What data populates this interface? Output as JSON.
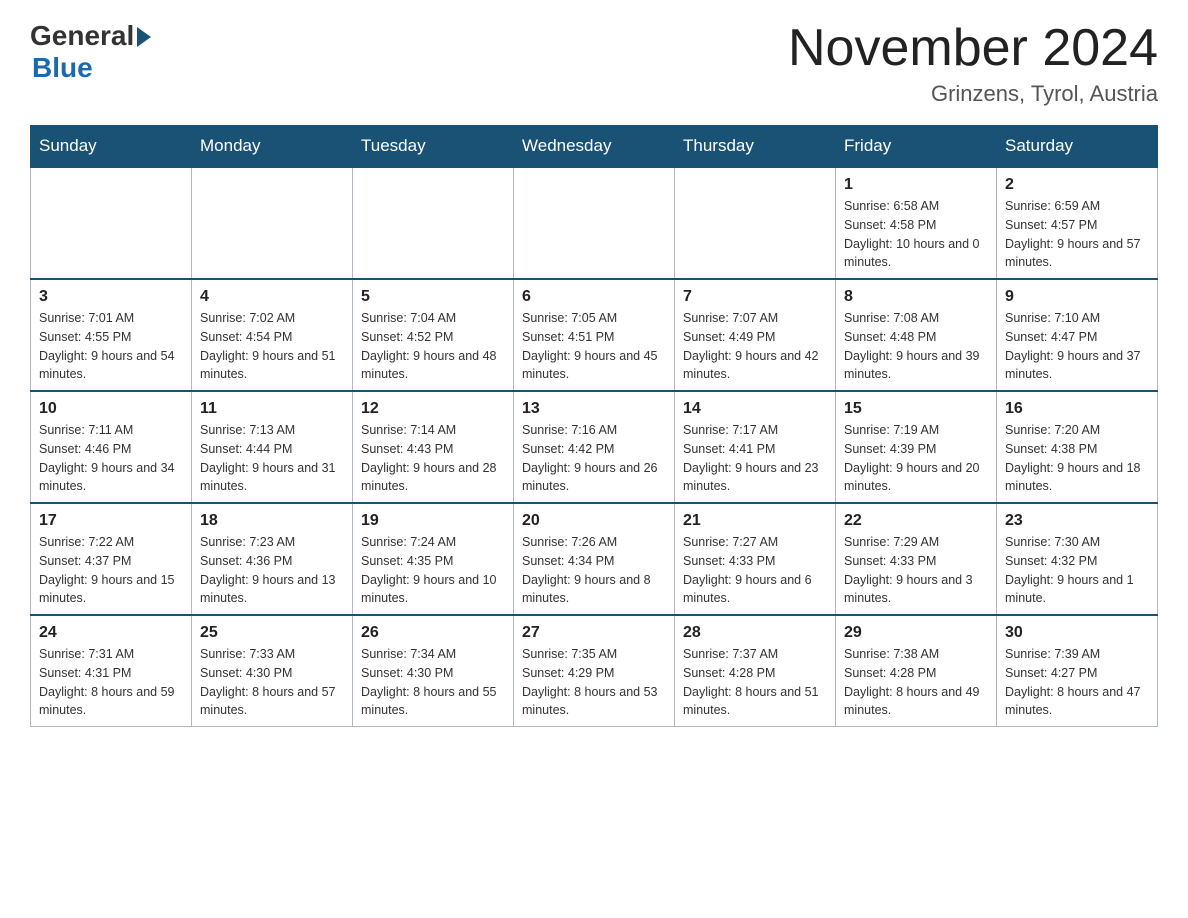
{
  "header": {
    "logo_general": "General",
    "logo_blue": "Blue",
    "title": "November 2024",
    "location": "Grinzens, Tyrol, Austria"
  },
  "days_of_week": [
    "Sunday",
    "Monday",
    "Tuesday",
    "Wednesday",
    "Thursday",
    "Friday",
    "Saturday"
  ],
  "weeks": [
    [
      {
        "day": "",
        "info": ""
      },
      {
        "day": "",
        "info": ""
      },
      {
        "day": "",
        "info": ""
      },
      {
        "day": "",
        "info": ""
      },
      {
        "day": "",
        "info": ""
      },
      {
        "day": "1",
        "info": "Sunrise: 6:58 AM\nSunset: 4:58 PM\nDaylight: 10 hours and 0 minutes."
      },
      {
        "day": "2",
        "info": "Sunrise: 6:59 AM\nSunset: 4:57 PM\nDaylight: 9 hours and 57 minutes."
      }
    ],
    [
      {
        "day": "3",
        "info": "Sunrise: 7:01 AM\nSunset: 4:55 PM\nDaylight: 9 hours and 54 minutes."
      },
      {
        "day": "4",
        "info": "Sunrise: 7:02 AM\nSunset: 4:54 PM\nDaylight: 9 hours and 51 minutes."
      },
      {
        "day": "5",
        "info": "Sunrise: 7:04 AM\nSunset: 4:52 PM\nDaylight: 9 hours and 48 minutes."
      },
      {
        "day": "6",
        "info": "Sunrise: 7:05 AM\nSunset: 4:51 PM\nDaylight: 9 hours and 45 minutes."
      },
      {
        "day": "7",
        "info": "Sunrise: 7:07 AM\nSunset: 4:49 PM\nDaylight: 9 hours and 42 minutes."
      },
      {
        "day": "8",
        "info": "Sunrise: 7:08 AM\nSunset: 4:48 PM\nDaylight: 9 hours and 39 minutes."
      },
      {
        "day": "9",
        "info": "Sunrise: 7:10 AM\nSunset: 4:47 PM\nDaylight: 9 hours and 37 minutes."
      }
    ],
    [
      {
        "day": "10",
        "info": "Sunrise: 7:11 AM\nSunset: 4:46 PM\nDaylight: 9 hours and 34 minutes."
      },
      {
        "day": "11",
        "info": "Sunrise: 7:13 AM\nSunset: 4:44 PM\nDaylight: 9 hours and 31 minutes."
      },
      {
        "day": "12",
        "info": "Sunrise: 7:14 AM\nSunset: 4:43 PM\nDaylight: 9 hours and 28 minutes."
      },
      {
        "day": "13",
        "info": "Sunrise: 7:16 AM\nSunset: 4:42 PM\nDaylight: 9 hours and 26 minutes."
      },
      {
        "day": "14",
        "info": "Sunrise: 7:17 AM\nSunset: 4:41 PM\nDaylight: 9 hours and 23 minutes."
      },
      {
        "day": "15",
        "info": "Sunrise: 7:19 AM\nSunset: 4:39 PM\nDaylight: 9 hours and 20 minutes."
      },
      {
        "day": "16",
        "info": "Sunrise: 7:20 AM\nSunset: 4:38 PM\nDaylight: 9 hours and 18 minutes."
      }
    ],
    [
      {
        "day": "17",
        "info": "Sunrise: 7:22 AM\nSunset: 4:37 PM\nDaylight: 9 hours and 15 minutes."
      },
      {
        "day": "18",
        "info": "Sunrise: 7:23 AM\nSunset: 4:36 PM\nDaylight: 9 hours and 13 minutes."
      },
      {
        "day": "19",
        "info": "Sunrise: 7:24 AM\nSunset: 4:35 PM\nDaylight: 9 hours and 10 minutes."
      },
      {
        "day": "20",
        "info": "Sunrise: 7:26 AM\nSunset: 4:34 PM\nDaylight: 9 hours and 8 minutes."
      },
      {
        "day": "21",
        "info": "Sunrise: 7:27 AM\nSunset: 4:33 PM\nDaylight: 9 hours and 6 minutes."
      },
      {
        "day": "22",
        "info": "Sunrise: 7:29 AM\nSunset: 4:33 PM\nDaylight: 9 hours and 3 minutes."
      },
      {
        "day": "23",
        "info": "Sunrise: 7:30 AM\nSunset: 4:32 PM\nDaylight: 9 hours and 1 minute."
      }
    ],
    [
      {
        "day": "24",
        "info": "Sunrise: 7:31 AM\nSunset: 4:31 PM\nDaylight: 8 hours and 59 minutes."
      },
      {
        "day": "25",
        "info": "Sunrise: 7:33 AM\nSunset: 4:30 PM\nDaylight: 8 hours and 57 minutes."
      },
      {
        "day": "26",
        "info": "Sunrise: 7:34 AM\nSunset: 4:30 PM\nDaylight: 8 hours and 55 minutes."
      },
      {
        "day": "27",
        "info": "Sunrise: 7:35 AM\nSunset: 4:29 PM\nDaylight: 8 hours and 53 minutes."
      },
      {
        "day": "28",
        "info": "Sunrise: 7:37 AM\nSunset: 4:28 PM\nDaylight: 8 hours and 51 minutes."
      },
      {
        "day": "29",
        "info": "Sunrise: 7:38 AM\nSunset: 4:28 PM\nDaylight: 8 hours and 49 minutes."
      },
      {
        "day": "30",
        "info": "Sunrise: 7:39 AM\nSunset: 4:27 PM\nDaylight: 8 hours and 47 minutes."
      }
    ]
  ]
}
